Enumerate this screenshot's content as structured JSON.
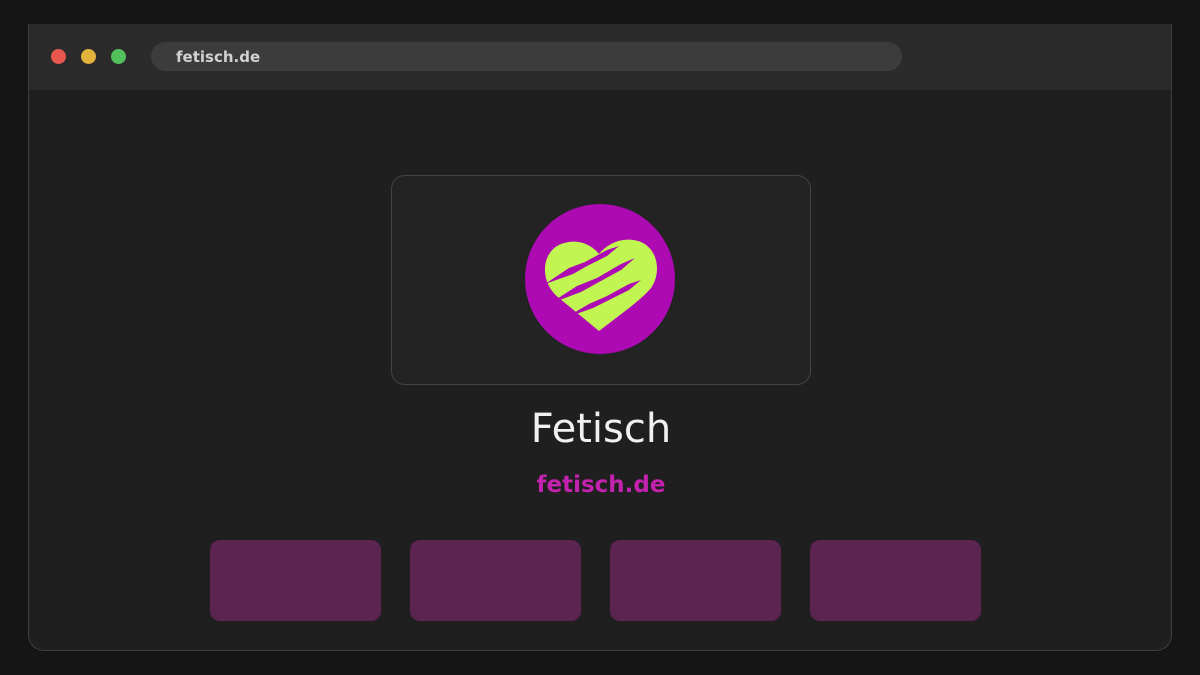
{
  "browser": {
    "url": "fetisch.de"
  },
  "site": {
    "name": "Fetisch",
    "domain": "fetisch.de",
    "logo_icon": "clawed-heart-icon"
  },
  "colors": {
    "accent": "#c222ad",
    "logo_circle": "#ad0ab3",
    "logo_heart": "#c0f552",
    "tile": "#5c2450",
    "page_background": "#1f1f1f"
  },
  "tiles": [
    {
      "name": "tile-1"
    },
    {
      "name": "tile-2"
    },
    {
      "name": "tile-3"
    },
    {
      "name": "tile-4"
    }
  ]
}
